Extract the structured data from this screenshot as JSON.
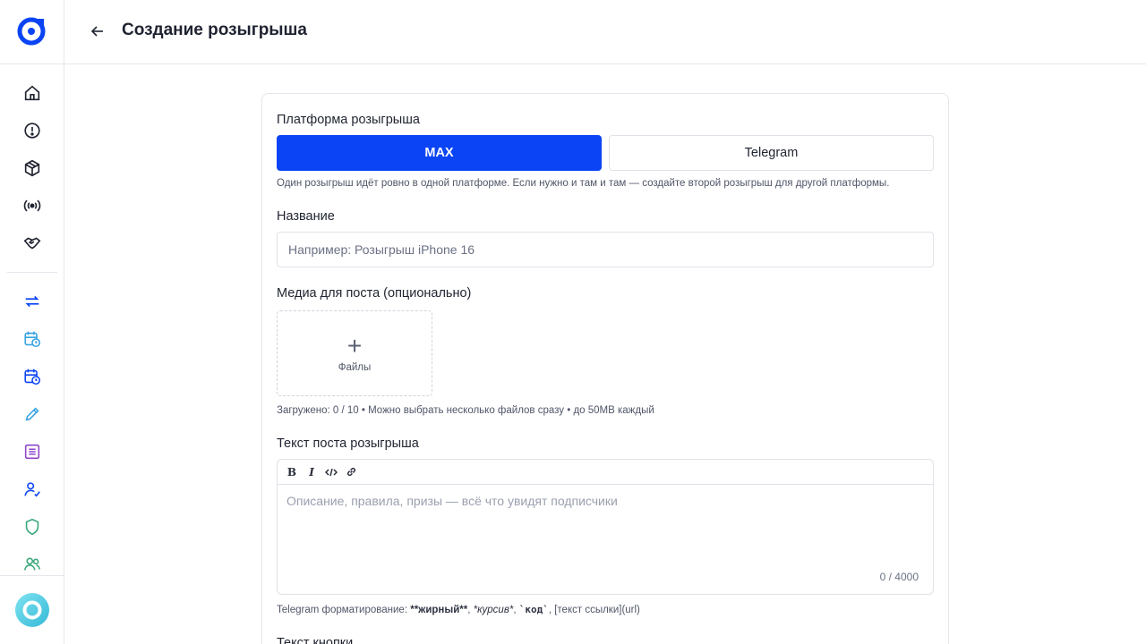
{
  "header": {
    "title": "Создание розыгрыша"
  },
  "sidebar": {
    "items": [
      {
        "icon": "home-icon"
      },
      {
        "icon": "alert-icon"
      },
      {
        "icon": "box-icon"
      },
      {
        "icon": "broadcast-icon"
      },
      {
        "icon": "handshake-icon"
      },
      {
        "icon": "repeat-icon"
      },
      {
        "icon": "calendar-clock-icon"
      },
      {
        "icon": "calendar-clock-icon"
      },
      {
        "icon": "pencil-icon"
      },
      {
        "icon": "list-icon"
      },
      {
        "icon": "user-check-icon"
      },
      {
        "icon": "shield-icon"
      },
      {
        "icon": "users-icon"
      }
    ],
    "colors": {
      "accent": "#0a44f5",
      "green": "#3aa87a",
      "purple": "#8e44c9",
      "cyan": "#36b9d8"
    }
  },
  "form": {
    "platform_label": "Платформа розыгрыша",
    "platform_options": [
      "MAX",
      "Telegram"
    ],
    "platform_selected": "MAX",
    "platform_hint": "Один розыгрыш идёт ровно в одной платформе. Если нужно и там и там — создайте второй розыгрыш для другой платформы.",
    "name_label": "Название",
    "name_placeholder": "Например: Розыгрыш iPhone 16",
    "media_label": "Медиа для поста (опционально)",
    "media_button": "Файлы",
    "media_hint": "Загружено: 0 / 10 • Можно выбрать несколько файлов сразу • до 50MB каждый",
    "text_label": "Текст поста розыгрыша",
    "text_placeholder": "Описание, правила, призы — всё что увидят подписчики",
    "text_counter": "0 / 4000",
    "format_prefix": "Telegram форматирование:",
    "format_bold": "**жирный**",
    "format_italic": "*курсив*",
    "format_code": "`код`",
    "format_link": "[текст ссылки](url)",
    "button_text_label": "Текст кнопки"
  }
}
